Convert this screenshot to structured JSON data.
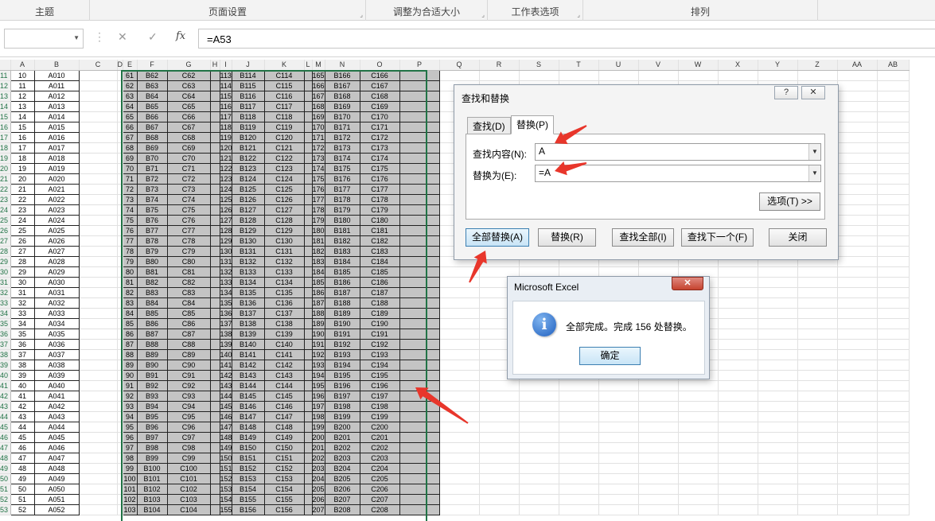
{
  "ribbon": {
    "groups": [
      {
        "label": "主题"
      },
      {
        "label": "页面设置"
      },
      {
        "label": "调整为合适大小"
      },
      {
        "label": "工作表选项"
      },
      {
        "label": "排列"
      }
    ]
  },
  "formula_bar": {
    "name_box": "",
    "cancel_icon": "✕",
    "enter_icon": "✓",
    "fx_icon": "fx",
    "formula": "=A53"
  },
  "sheet": {
    "columns": [
      "A",
      "B",
      "C",
      "D",
      "E",
      "F",
      "G",
      "H",
      "I",
      "J",
      "K",
      "L",
      "M",
      "N",
      "O",
      "P",
      "Q",
      "R",
      "S",
      "T",
      "U",
      "V",
      "W",
      "X",
      "Y",
      "Z",
      "AA",
      "AB"
    ],
    "first_row": 11,
    "last_row": 53,
    "first_value": 10,
    "selection_color": "#c4c4c4"
  },
  "find_dialog": {
    "title": "查找和替换",
    "help_icon": "?",
    "close_icon": "✕",
    "tab_find": "查找(D)",
    "tab_replace": "替换(P)",
    "find_label": "查找内容(N):",
    "find_value": "A",
    "replace_label": "替换为(E):",
    "replace_value": "=A",
    "options_button": "选项(T) >>",
    "replace_all_button": "全部替换(A)",
    "replace_button": "替换(R)",
    "find_all_button": "查找全部(I)",
    "find_next_button": "查找下一个(F)",
    "close_button": "关闭"
  },
  "message_dialog": {
    "title": "Microsoft Excel",
    "close_icon": "✕",
    "info_icon": "i",
    "message": "全部完成。完成 156 处替换。",
    "ok_button": "确定"
  },
  "annotation_color": "#e8362b"
}
